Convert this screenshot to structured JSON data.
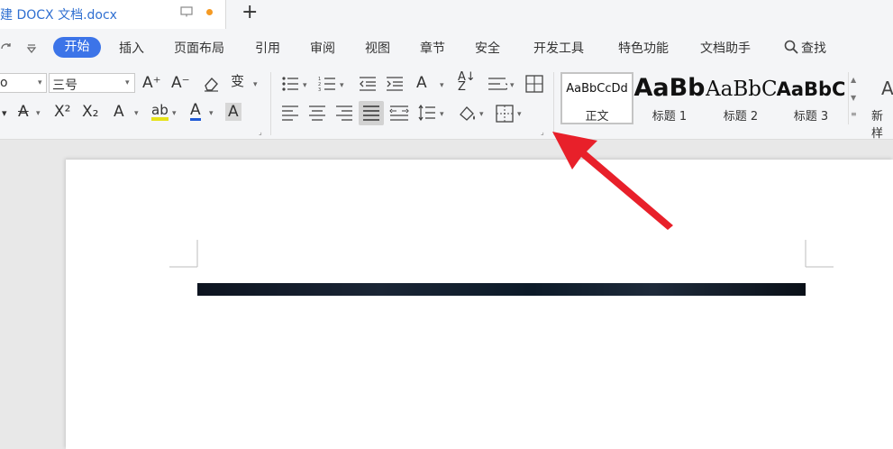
{
  "tab": {
    "title": "建 DOCX 文档.docx",
    "new_tab": "+"
  },
  "menu": {
    "items": [
      "开始",
      "插入",
      "页面布局",
      "引用",
      "审阅",
      "视图",
      "章节",
      "安全",
      "开发工具",
      "特色功能",
      "文档助手"
    ],
    "search": "查找"
  },
  "font": {
    "size": "三号",
    "name_partial": "o"
  },
  "styles": [
    {
      "sample": "AaBbCcDd",
      "label": "正文"
    },
    {
      "sample": "AaBb",
      "label": "标题 1"
    },
    {
      "sample": "AaBbC",
      "label": "标题 2"
    },
    {
      "sample": "AaBbC",
      "label": "标题 3"
    },
    {
      "sample": "A",
      "label": "新样"
    }
  ],
  "colors": {
    "accent": "#3c74e8",
    "tab_text": "#2f6fd1",
    "dot": "#f59a23",
    "arrow": "#e8202a"
  }
}
